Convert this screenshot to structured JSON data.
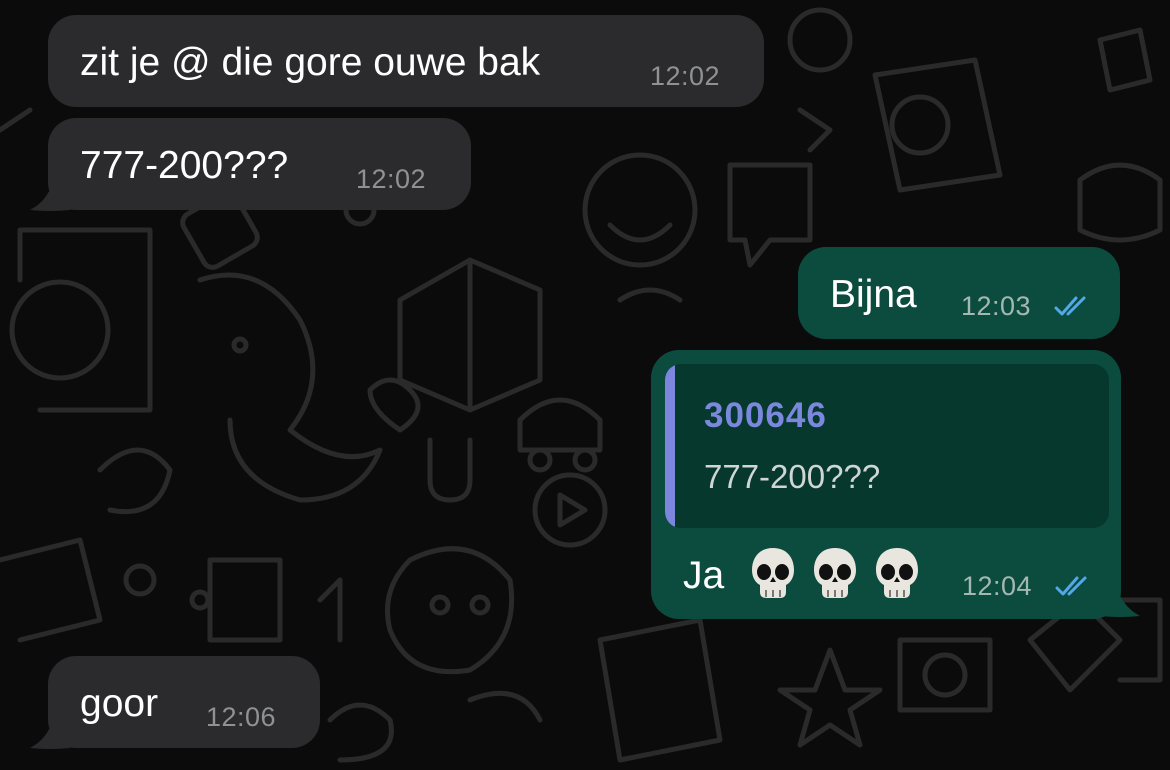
{
  "colors": {
    "background": "#0b0b0b",
    "incoming_bubble": "#2b2b2d",
    "outgoing_bubble": "#0c4c3f",
    "quote_background": "#06382e",
    "quote_accent": "#7c86dc",
    "read_ticks": "#52a8e8"
  },
  "messages": [
    {
      "direction": "incoming",
      "text": "zit je @ die gore ouwe bak",
      "time": "12:02"
    },
    {
      "direction": "incoming",
      "text": "777-200???",
      "time": "12:02"
    },
    {
      "direction": "outgoing",
      "text": "Bijna",
      "time": "12:03",
      "status_icon": "double-check-read-icon"
    },
    {
      "direction": "outgoing",
      "quoted": {
        "author": "300646",
        "text": "777-200???"
      },
      "text": "Ja",
      "emoji_icons": [
        "skull-emoji-icon",
        "skull-emoji-icon",
        "skull-emoji-icon"
      ],
      "time": "12:04",
      "status_icon": "double-check-read-icon"
    },
    {
      "direction": "incoming",
      "text": "goor",
      "time": "12:06"
    }
  ]
}
